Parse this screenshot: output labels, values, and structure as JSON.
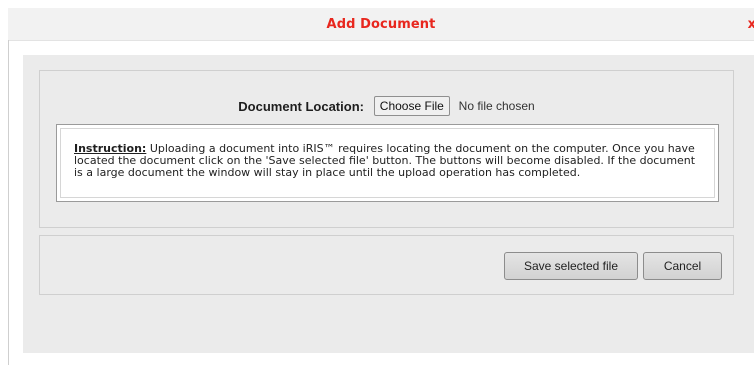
{
  "dialog": {
    "title": "Add Document",
    "close_label": "x"
  },
  "upload": {
    "location_label": "Document Location:",
    "choose_file_label": "Choose File",
    "file_status": "No file chosen"
  },
  "instruction": {
    "heading": "Instruction:",
    "text": " Uploading a document into iRIS™ requires locating the document on the computer. Once you have located the document click on the 'Save selected file' button. The buttons will become disabled. If the document is a large document the window will stay in place until the upload operation has completed."
  },
  "actions": {
    "save_label": "Save selected file",
    "cancel_label": "Cancel"
  },
  "colors": {
    "title_accent": "#e8271e",
    "panel_background": "#ebebeb"
  }
}
